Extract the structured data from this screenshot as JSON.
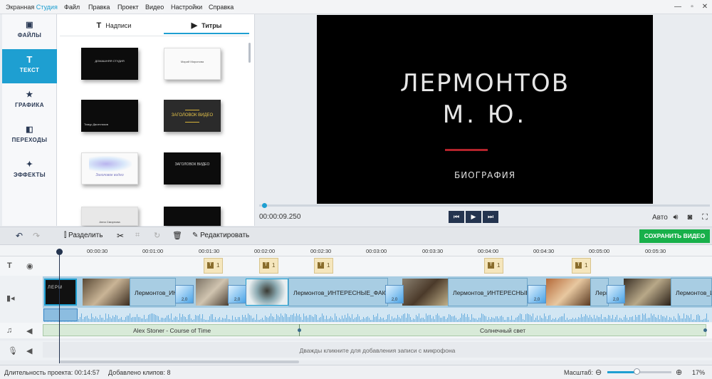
{
  "app": {
    "name_main": "Экранная ",
    "name_accent": "Студия"
  },
  "menu": [
    "Файл",
    "Правка",
    "Проект",
    "Видео",
    "Настройки",
    "Справка"
  ],
  "window_controls": {
    "minimize": "—",
    "restore": "▫",
    "close": "✕"
  },
  "sidebar": {
    "items": [
      {
        "label": "ФАЙЛЫ",
        "icon": "image-icon"
      },
      {
        "label": "ТЕКСТ",
        "icon": "text-icon",
        "active": true
      },
      {
        "label": "ГРАФИКА",
        "icon": "star-icon"
      },
      {
        "label": "ПЕРЕХОДЫ",
        "icon": "transitions-icon"
      },
      {
        "label": "ЭФФЕКТЫ",
        "icon": "magic-wand-icon"
      }
    ]
  },
  "library": {
    "tabs": [
      {
        "label": "Надписи",
        "icon": "T"
      },
      {
        "label": "Титры",
        "icon": "▶",
        "active": true
      }
    ],
    "thumbs": [
      {
        "style": "dark",
        "text": "ДОМАШНЯЯ СТУДИЯ"
      },
      {
        "style": "light",
        "text": "Марий Миронова"
      },
      {
        "style": "dark",
        "text": "Тимур Двоеглазов"
      },
      {
        "style": "grey",
        "text": "ЗАГОЛОВОК ВИДЕО"
      },
      {
        "style": "light",
        "text": "Заголовок видео"
      },
      {
        "style": "dark",
        "text": "ЗАГОЛОВОК ВИДЕО"
      },
      {
        "style": "light",
        "text": "Анна Смирнова"
      },
      {
        "style": "dark",
        "text": ""
      }
    ]
  },
  "preview": {
    "title_line1": "ЛЕРМОНТОВ",
    "title_line2": "М. Ю.",
    "subtitle": "БИОГРАФИЯ",
    "timecode": "00:00:09.250",
    "progress": 0.01,
    "auto_label": "Авто",
    "controls": [
      "prev-frame",
      "play",
      "next-frame"
    ]
  },
  "toolbar": {
    "split": "Разделить",
    "edit": "Редактировать",
    "save": "СОХРАНИТЬ ВИДЕО"
  },
  "ruler": [
    "00:00:30",
    "00:01:00",
    "00:01:30",
    "00:02:00",
    "00:02:30",
    "00:03:00",
    "00:03:30",
    "00:04:00",
    "00:04:30",
    "00:05:00",
    "00:05:30"
  ],
  "title_markers": [
    "1",
    "1",
    "1",
    "1",
    "1"
  ],
  "clips": [
    {
      "label": "Лермонтов_ИН"
    },
    {
      "label": "Лермонтов_ИНТЕРЕСНЫЕ_ФАКТЫ"
    },
    {
      "label": "Лермонтов_ИНТЕРЕСНЫЕ_Ф"
    },
    {
      "label": "Лерм"
    },
    {
      "label": "Лермонтов_И"
    }
  ],
  "transitions": [
    "2,0",
    "2,0",
    "2,0",
    "2,0",
    "2,0"
  ],
  "music": [
    {
      "label": "Alex Stoner - Course of Time"
    },
    {
      "label": "Солнечный свет"
    }
  ],
  "mic_hint": "Дважды кликните для добавления записи с микрофона",
  "status": {
    "duration": "Длительность проекта: 00:14:57",
    "clips_added": "Добавлено клипов: 8",
    "zoom_label": "Масштаб:",
    "zoom_value": "17%",
    "zoom_level": 0.17
  },
  "colors": {
    "accent": "#1e9fd1",
    "save_green": "#18b04a",
    "marker": "#b3232b"
  }
}
